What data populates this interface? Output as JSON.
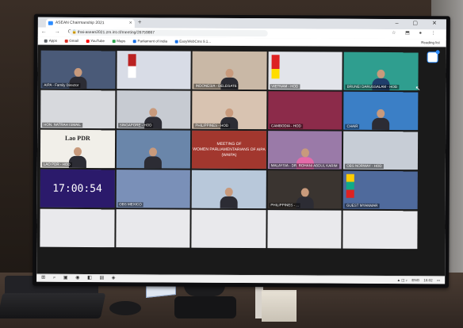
{
  "browser": {
    "tab_title": "ASEAN Chairmanship 2021",
    "url": "thai-asean2021.zm.int.cf/meeting/26759867",
    "bookmarks": [
      {
        "label": "Apps",
        "icon": "apps-grid-icon",
        "color": "#5f6368"
      },
      {
        "label": "Gmail",
        "icon": "gmail-icon",
        "color": "#d93025"
      },
      {
        "label": "YouTube",
        "icon": "youtube-icon",
        "color": "#ff0000"
      },
      {
        "label": "Maps",
        "icon": "maps-icon",
        "color": "#34a853"
      },
      {
        "label": "Parliament of India",
        "icon": "page-icon",
        "color": "#1a73e8"
      },
      {
        "label": "EasyWebCms 9.1...",
        "icon": "page-icon",
        "color": "#1a73e8"
      }
    ],
    "reading_list": "Reading list"
  },
  "zoom": {
    "timer": "17:00:54",
    "meeting_card_lines": [
      "MEETING OF",
      "WOMEN PARLIAMENTARIANS OF AIPA",
      "(WAIPA)"
    ],
    "lao_banner": "Lao PDR",
    "tiles": [
      {
        "label": "AIPA - Family Director"
      },
      {
        "label": ""
      },
      {
        "label": "INDONESIA - DELEGATE"
      },
      {
        "label": "VIETNAM - HOD"
      },
      {
        "label": "BRUNEI DARUSSALAM - HOD"
      },
      {
        "label": "HON. NATRAH ISMAIL"
      },
      {
        "label": "SINGAPORE - HOD"
      },
      {
        "label": "PHILIPPINES - HOD"
      },
      {
        "label": "CAMBODIA - HOD"
      },
      {
        "label": "CHAIR"
      },
      {
        "label": "LAO PDR - HOD"
      },
      {
        "label": ""
      },
      {
        "label": ""
      },
      {
        "label": "MALAYSIA - DR. ROHANI ABDUL KARIM"
      },
      {
        "label": "OBS NORWAY - HOD"
      },
      {
        "label": ""
      },
      {
        "label": "OBS MEXICO"
      },
      {
        "label": ""
      },
      {
        "label": "PHILIPPINES - ..."
      },
      {
        "label": "GUEST MYANMAR"
      }
    ]
  },
  "taskbar": {
    "language": "ENG",
    "time": "16:02"
  },
  "colors": {
    "zoom_blue": "#2d8cff",
    "timer_bg": "#2b1a6b",
    "meeting_card_bg": "#a2372e"
  }
}
